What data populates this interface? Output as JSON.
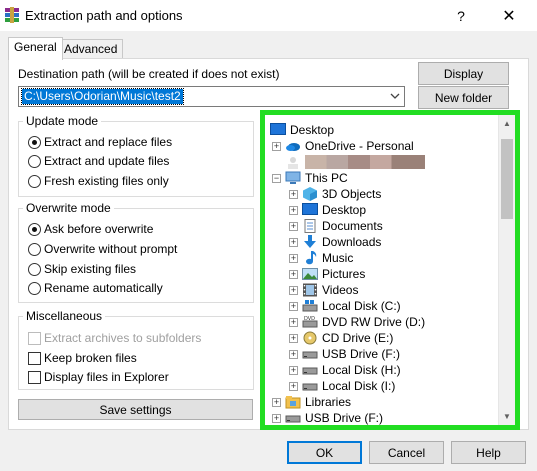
{
  "window": {
    "title": "Extraction path and options",
    "help": "?",
    "close": "✕"
  },
  "tabs": [
    "General",
    "Advanced"
  ],
  "destination": {
    "label": "Destination path (will be created if does not exist)",
    "value": "C:\\Users\\Odorian\\Music\\test2"
  },
  "buttons": {
    "display": "Display",
    "new_folder": "New folder",
    "save_settings": "Save settings"
  },
  "update_mode": {
    "title": "Update mode",
    "options": [
      "Extract and replace files",
      "Extract and update files",
      "Fresh existing files only"
    ],
    "selected": 0
  },
  "overwrite_mode": {
    "title": "Overwrite mode",
    "options": [
      "Ask before overwrite",
      "Overwrite without prompt",
      "Skip existing files",
      "Rename automatically"
    ],
    "selected": 0
  },
  "misc": {
    "title": "Miscellaneous",
    "options": [
      "Extract archives to subfolders",
      "Keep broken files",
      "Display files in Explorer"
    ]
  },
  "tree": {
    "items": [
      {
        "label": "Desktop",
        "icon": "desktop-icon"
      },
      {
        "label": "OneDrive - Personal",
        "icon": "onedrive-cloud-icon",
        "expander": "+"
      },
      {
        "label": "",
        "icon": "user-folder-icon",
        "expander": "+"
      },
      {
        "label": "This PC",
        "icon": "pc-icon",
        "expander": "−"
      },
      {
        "label": "3D Objects",
        "icon": "3d-objects-icon",
        "expander": "+"
      },
      {
        "label": "Desktop",
        "icon": "desktop-icon",
        "expander": "+"
      },
      {
        "label": "Documents",
        "icon": "documents-icon",
        "expander": "+"
      },
      {
        "label": "Downloads",
        "icon": "downloads-icon",
        "expander": "+"
      },
      {
        "label": "Music",
        "icon": "music-icon",
        "expander": "+"
      },
      {
        "label": "Pictures",
        "icon": "pictures-icon",
        "expander": "+"
      },
      {
        "label": "Videos",
        "icon": "videos-icon",
        "expander": "+"
      },
      {
        "label": "Local Disk (C:)",
        "icon": "local-disk-icon",
        "expander": "+"
      },
      {
        "label": "DVD RW Drive (D:)",
        "icon": "dvd-drive-icon",
        "expander": "+"
      },
      {
        "label": "CD Drive (E:)",
        "icon": "cd-drive-icon",
        "expander": "+"
      },
      {
        "label": "USB Drive (F:)",
        "icon": "usb-drive-icon",
        "expander": "+"
      },
      {
        "label": "Local Disk (H:)",
        "icon": "local-disk-icon",
        "expander": "+"
      },
      {
        "label": "Local Disk (I:)",
        "icon": "local-disk-icon",
        "expander": "+"
      },
      {
        "label": "Libraries",
        "icon": "libraries-icon",
        "expander": "+"
      },
      {
        "label": "USB Drive (F:)",
        "icon": "usb-drive-icon",
        "expander": "+"
      }
    ]
  },
  "footer": {
    "ok": "OK",
    "cancel": "Cancel",
    "help": "Help"
  },
  "colors": {
    "accent": "#0078d7",
    "highlight_frame": "#22dd22"
  }
}
